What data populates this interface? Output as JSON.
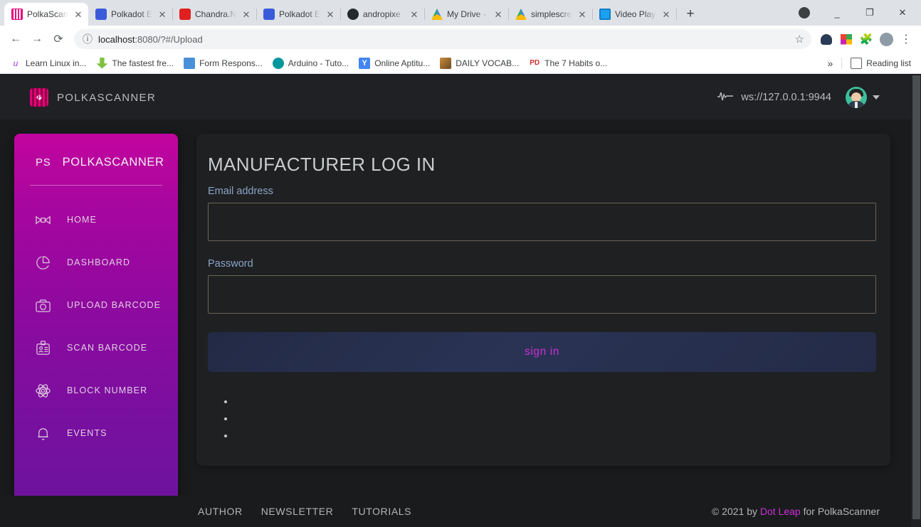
{
  "browser": {
    "tabs": [
      {
        "title": "PolkaScan",
        "favicon": "polkascanner-icon",
        "active": true
      },
      {
        "title": "Polkadot E",
        "favicon": "polkadot-icon",
        "active": false
      },
      {
        "title": "Chandra.N",
        "favicon": "chandra-icon",
        "active": false
      },
      {
        "title": "Polkadot E",
        "favicon": "polkadot-icon",
        "active": false
      },
      {
        "title": "andropixe",
        "favicon": "github-icon",
        "active": false
      },
      {
        "title": "My Drive -",
        "favicon": "google-drive-icon",
        "active": false
      },
      {
        "title": "simplescre",
        "favicon": "google-drive-icon",
        "active": false
      },
      {
        "title": "Video Play",
        "favicon": "video-player-icon",
        "active": false
      }
    ],
    "new_tab_label": "+",
    "window_controls": {
      "profile": "profile-pill-icon",
      "minimize": "_",
      "maximize": "❐",
      "close": "✕"
    },
    "toolbar": {
      "back": "←",
      "forward": "→",
      "reload": "⟳",
      "site_info": "ⓘ",
      "url_host": "localhost",
      "url_rest": ":8080/?#/Upload",
      "bookmark_star": "☆",
      "extensions": [
        "ninja-extension-icon",
        "colorgrid-extension-icon",
        "puzzle-extensions-icon"
      ],
      "profile": "user-avatar-icon",
      "menu": "⋮"
    },
    "bookmarks": [
      {
        "label": "Learn Linux in...",
        "icon": "udemy-icon"
      },
      {
        "label": "The fastest fre...",
        "icon": "download-icon"
      },
      {
        "label": "Form Respons...",
        "icon": "forms-icon"
      },
      {
        "label": "Arduino - Tuto...",
        "icon": "arduino-icon"
      },
      {
        "label": "Online Aptitu...",
        "icon": "yahoo-icon"
      },
      {
        "label": "DAILY VOCAB...",
        "icon": "vocab-icon"
      },
      {
        "label": "The 7 Habits o...",
        "icon": "pdf-icon"
      }
    ],
    "bookmarks_overflow": "»",
    "reading_list": "Reading list",
    "reading_list_icon": "reading-list-icon"
  },
  "app": {
    "header": {
      "brand": "POLKASCANNER",
      "brand_icon": "polkascanner-logo",
      "ws_endpoint": "ws://127.0.0.1:9944",
      "ws_icon": "heartbeat-icon",
      "avatar": "user-avatar",
      "caret": "chevron-down-icon"
    },
    "sidebar": {
      "abbr": "PS",
      "title": "POLKASCANNER",
      "items": [
        {
          "label": "HOME",
          "icon": "bowtie-icon"
        },
        {
          "label": "DASHBOARD",
          "icon": "pie-chart-icon"
        },
        {
          "label": "UPLOAD BARCODE",
          "icon": "camera-icon"
        },
        {
          "label": "SCAN BARCODE",
          "icon": "id-card-icon"
        },
        {
          "label": "BLOCK NUMBER",
          "icon": "atom-icon"
        },
        {
          "label": "EVENTS",
          "icon": "bell-icon"
        }
      ]
    },
    "login": {
      "title": "MANUFACTURER LOG IN",
      "email_label": "Email address",
      "email_value": "",
      "email_placeholder": "",
      "password_label": "Password",
      "password_value": "",
      "password_placeholder": "",
      "submit_label": "sign in",
      "messages": [
        "",
        "",
        ""
      ]
    },
    "footer": {
      "links": [
        "AUTHOR",
        "NEWSLETTER",
        "TUTORIALS"
      ],
      "copyright_prefix": "© 2021 by ",
      "copyright_accent": "Dot Leap",
      "copyright_suffix": " for PolkaScanner"
    },
    "colors": {
      "page_bg": "#1a1b1d",
      "card_bg": "#1f2022",
      "sidebar_top": "#c2059e",
      "sidebar_bottom": "#6a149d",
      "accent": "#cc2fd9",
      "label_blue": "#8aa4c8",
      "button_bg": "#2a3354"
    }
  }
}
